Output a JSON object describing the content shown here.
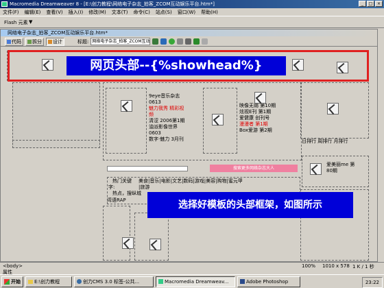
{
  "window": {
    "title": "Macromedia Dreamweaver 8 - [E:\\创力教程\\网络电子杂志_拍客_ZCOM互动娱乐平台.htm*]"
  },
  "menu": [
    "文件(F)",
    "编辑(E)",
    "查看(V)",
    "插入(I)",
    "修改(M)",
    "文本(T)",
    "命令(C)",
    "站点(S)",
    "窗口(W)",
    "帮助(H)"
  ],
  "insert_bar": {
    "category": "Flash 元素",
    "dropdown": "▼"
  },
  "document": {
    "tab_title": "网络电子杂志_拍客_ZCOM互动娱乐平台.htm*",
    "toolbar": {
      "code": "代码",
      "split": "拆分",
      "design": "设计",
      "title_label": "标题:",
      "title_value": "网络电子杂志_拍客_ZCOM互动娱乐平台"
    }
  },
  "canvas": {
    "magazine_list": [
      {
        "text": "9eye音乐杂志",
        "color": "#000000"
      },
      {
        "text": "0613",
        "color": "#000000"
      },
      {
        "text": "魅力我秀 精彩视",
        "color": "#e00000"
      },
      {
        "text": "频",
        "color": "#e00000"
      },
      {
        "text": "清涩 2006第1期",
        "color": "#000000"
      },
      {
        "text": "油派影像世界",
        "color": "#000000"
      },
      {
        "text": "0603",
        "color": "#000000"
      },
      {
        "text": "数字·魅力 3月刊",
        "color": "#000000"
      }
    ],
    "right_list": [
      {
        "text": "映像无锡 第10期",
        "color": "#000000"
      },
      {
        "text": "炫视E刊 第1期",
        "color": "#000000"
      },
      {
        "text": "爱健康 创刊号",
        "color": "#000000"
      },
      {
        "text": "漫漫者 第1期",
        "color": "#e00000"
      },
      {
        "text": "Box爱游 第2期",
        "color": "#000000"
      }
    ],
    "rank_tabs": "日排行  周排行  月排行",
    "side_item": "爱美丽me 第",
    "side_item2": "80期",
    "keyword_label": "热门关键",
    "keyword_label2": "字:",
    "keyword_cats": "美食|音乐|电影|文艺|数码|游戏|美容|购物|蜜元甲",
    "keyword_more": "|旅游",
    "hot_label": "热点，搜纵城",
    "hot_line2": "湾语RAP",
    "pink_text": "搜索更多网络杂志大人"
  },
  "annotation_head": "网页头部--{%showhead%}",
  "annotation_tip": "选择好模板的头部框架，如图所示",
  "status": {
    "left": "<body>",
    "zoom": "100%",
    "size": "1010 x 578",
    "weight": "1 K / 1 秒",
    "props": "属性"
  },
  "taskbar": {
    "start": "开始",
    "items": [
      "E:\\创力教程",
      "创力CMS 3.0 标签-公共...",
      "Macromedia Dreamweav...",
      "Adobe Photoshop"
    ],
    "clock": "23:22"
  },
  "colors": {
    "annotation_bg": "#0000d8",
    "annotation_border": "#e02020",
    "accent_red": "#e00000",
    "titlebar": "#0a246a"
  }
}
